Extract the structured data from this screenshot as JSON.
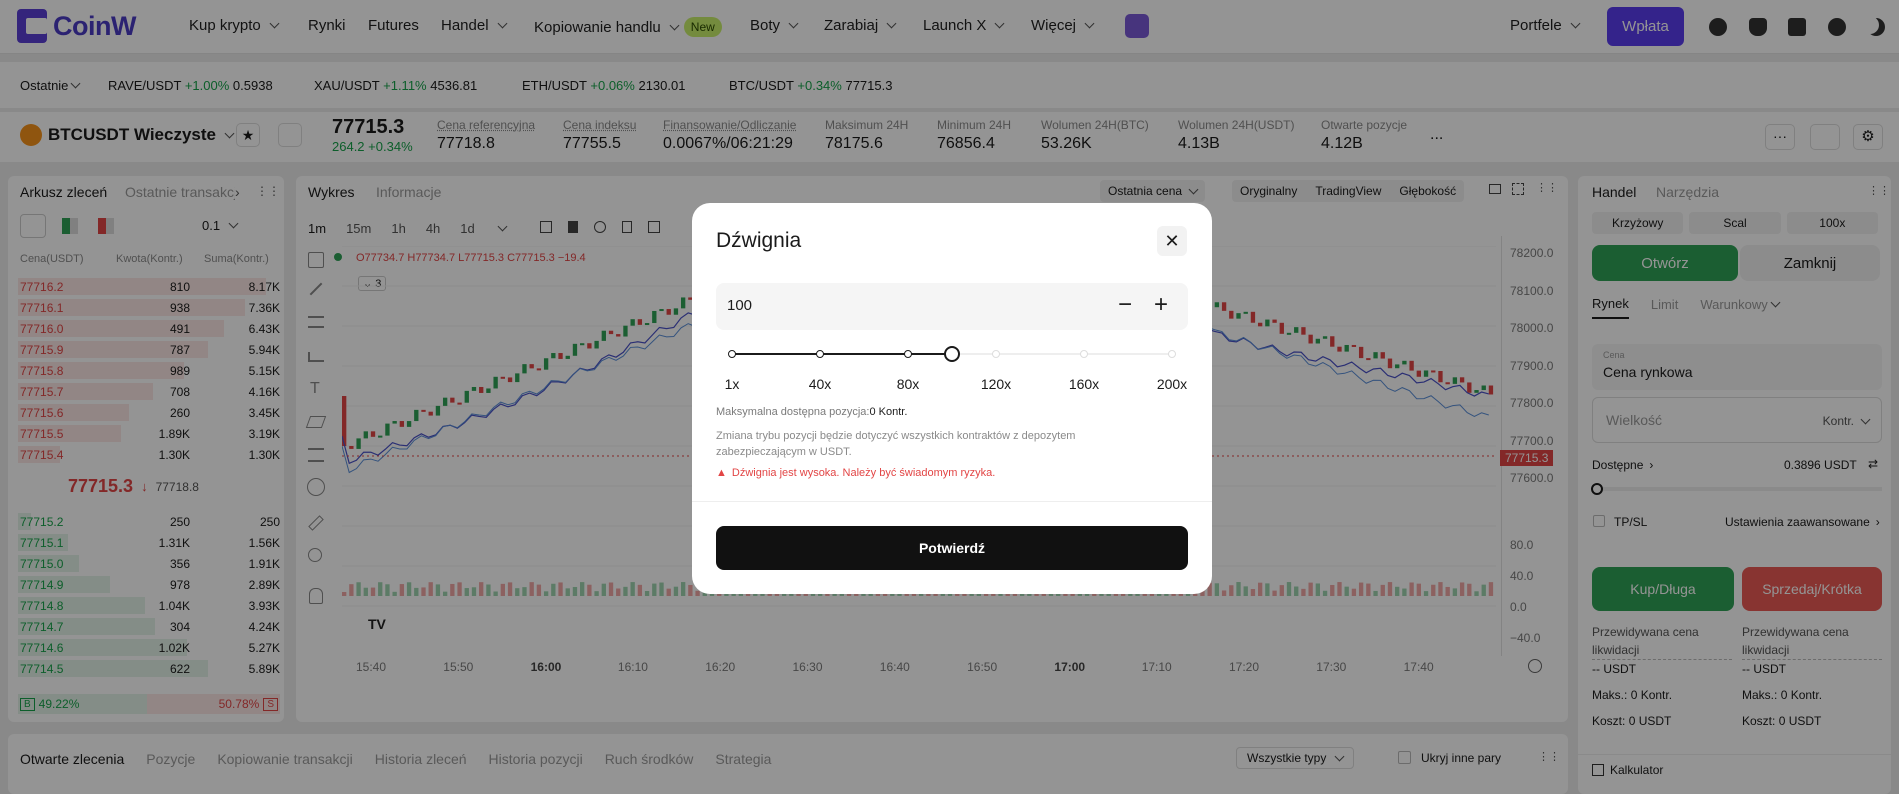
{
  "brand": {
    "name": "CoinW"
  },
  "nav": {
    "items": [
      "Kup krypto",
      "Rynki",
      "Futures",
      "Handel",
      "Kopiowanie handlu",
      "Boty",
      "Zarabiaj",
      "Launch X",
      "Więcej"
    ],
    "new_badge": "New",
    "wallets": "Portfele",
    "deposit": "Wpłata"
  },
  "ticker": {
    "filter": "Ostatnie",
    "pairs": [
      {
        "name": "RAVE/USDT",
        "change": "+1.00%",
        "price": "0.5938"
      },
      {
        "name": "XAU/USDT",
        "change": "+1.11%",
        "price": "4536.81"
      },
      {
        "name": "ETH/USDT",
        "change": "+0.06%",
        "price": "2130.01"
      },
      {
        "name": "BTC/USDT",
        "change": "+0.34%",
        "price": "77715.3"
      }
    ]
  },
  "pair": {
    "symbol": "BTCUSDT Wieczyste",
    "last_price": "77715.3",
    "change_abs": "264.2",
    "change_pct": "+0.34%",
    "stats": [
      {
        "label": "Cena referencyjna",
        "value": "77718.8"
      },
      {
        "label": "Cena indeksu",
        "value": "77755.5"
      },
      {
        "label": "Finansowanie/Odliczanie",
        "value": "0.0067%/06:21:29"
      },
      {
        "label": "Maksimum 24H",
        "value": "78175.6"
      },
      {
        "label": "Minimum 24H",
        "value": "76856.4"
      },
      {
        "label": "Wolumen 24H(BTC)",
        "value": "53.26K"
      },
      {
        "label": "Wolumen 24H(USDT)",
        "value": "4.13B"
      },
      {
        "label": "Otwarte pozycje",
        "value": "4.12B"
      }
    ],
    "more": "..."
  },
  "orderbook": {
    "tab_active": "Arkusz zleceń",
    "tab_other": "Ostatnie transakcje",
    "precision": "0.1",
    "headers": [
      "Cena(USDT)",
      "Kwota(Kontr.)",
      "Suma(Kontr.)"
    ],
    "asks": [
      [
        "77716.2",
        "810",
        "8.17K"
      ],
      [
        "77716.1",
        "938",
        "7.36K"
      ],
      [
        "77716.0",
        "491",
        "6.43K"
      ],
      [
        "77715.9",
        "787",
        "5.94K"
      ],
      [
        "77715.8",
        "989",
        "5.15K"
      ],
      [
        "77715.7",
        "708",
        "4.16K"
      ],
      [
        "77715.6",
        "260",
        "3.45K"
      ],
      [
        "77715.5",
        "1.89K",
        "3.19K"
      ],
      [
        "77715.4",
        "1.30K",
        "1.30K"
      ]
    ],
    "mid_price": "77715.3",
    "mid_arrow": "↓",
    "mid_mark": "77718.8",
    "bids": [
      [
        "77715.2",
        "250",
        "250"
      ],
      [
        "77715.1",
        "1.31K",
        "1.56K"
      ],
      [
        "77715.0",
        "356",
        "1.91K"
      ],
      [
        "77714.9",
        "978",
        "2.89K"
      ],
      [
        "77714.8",
        "1.04K",
        "3.93K"
      ],
      [
        "77714.7",
        "304",
        "4.24K"
      ],
      [
        "77714.6",
        "1.02K",
        "5.27K"
      ],
      [
        "77714.5",
        "622",
        "5.89K"
      ]
    ],
    "buy_label": "B",
    "buy_pct": "49.22%",
    "sell_pct": "50.78%",
    "sell_label": "S",
    "ask_depth": [
      0.94,
      0.86,
      0.78,
      0.72,
      0.63,
      0.51,
      0.42,
      0.39,
      0.16
    ],
    "bid_depth": [
      0.05,
      0.19,
      0.23,
      0.35,
      0.48,
      0.52,
      0.64,
      0.72
    ]
  },
  "chart": {
    "tab_active": "Wykres",
    "tab_other": "Informacje",
    "price_type": "Ostatnia cena",
    "views": [
      "Oryginalny",
      "TradingView",
      "Głębokość"
    ],
    "intervals": [
      "1m",
      "15m",
      "1h",
      "4h",
      "1d"
    ],
    "ohlc": "O77734.7  H77734.7  L77715.3  C77715.3  −19.4",
    "collapse_count": "3",
    "price_axis": [
      "78200.0",
      "78100.0",
      "78000.0",
      "77900.0",
      "77800.0",
      "77700.0",
      "77600.0"
    ],
    "current_price_tag": "77715.3",
    "vol_axis": [
      "80.0",
      "40.0",
      "0.0",
      "−40.0"
    ],
    "time_axis": [
      "15:40",
      "15:50",
      "16:00",
      "16:10",
      "16:20",
      "16:30",
      "16:40",
      "16:50",
      "17:00",
      "17:10",
      "17:20",
      "17:30",
      "17:40"
    ],
    "tv_logo": "TV"
  },
  "trade": {
    "tab_active": "Handel",
    "tab_other": "Narzędzia",
    "margin": "Krzyżowy",
    "mode": "Scal",
    "leverage": "100x",
    "open": "Otwórz",
    "close": "Zamknij",
    "order_types": [
      "Rynek",
      "Limit",
      "Warunkowy"
    ],
    "price_label": "Cena",
    "price_value": "Cena rynkowa",
    "qty_placeholder": "Wielkość",
    "qty_unit": "Kontr.",
    "available_label": "Dostępne",
    "available_value": "0.3896 USDT",
    "tpsl": "TP/SL",
    "advanced": "Ustawienia zaawansowane",
    "buy": "Kup/Długa",
    "sell": "Sprzedaj/Krótka",
    "liq_label": "Przewidywana cena likwidacji",
    "liq_value": "-- USDT",
    "max_label": "Maks.:",
    "max_value": "0 Kontr.",
    "cost_label": "Koszt:",
    "cost_value": "0 USDT",
    "calculator": "Kalkulator"
  },
  "bottom": {
    "tabs": [
      "Otwarte zlecenia",
      "Pozycje",
      "Kopiowanie transakcji",
      "Historia zleceń",
      "Historia pozycji",
      "Ruch środków",
      "Strategia"
    ],
    "filter": "Wszystkie typy",
    "hide_pairs": "Ukryj inne pary"
  },
  "modal": {
    "title": "Dźwignia",
    "value": "100",
    "min_label": "−",
    "plus_label": "+",
    "marks": [
      "1x",
      "40x",
      "80x",
      "120x",
      "160x",
      "200x"
    ],
    "slider_level": 0.5,
    "max_position_label": "Maksymalna dostępna pozycja:",
    "max_position_value": "0 Kontr.",
    "info": "Zmiana trybu pozycji będzie dotyczyć wszystkich kontraktów z depozytem zabezpieczającym w USDT.",
    "warning": "Dźwignia jest wysoka. Należy być świadomym ryzyka.",
    "confirm": "Potwierdź"
  },
  "colors": {
    "accent": "#5b3df0",
    "up": "#2fa356",
    "down": "#e24545",
    "warning": "#e24545"
  }
}
